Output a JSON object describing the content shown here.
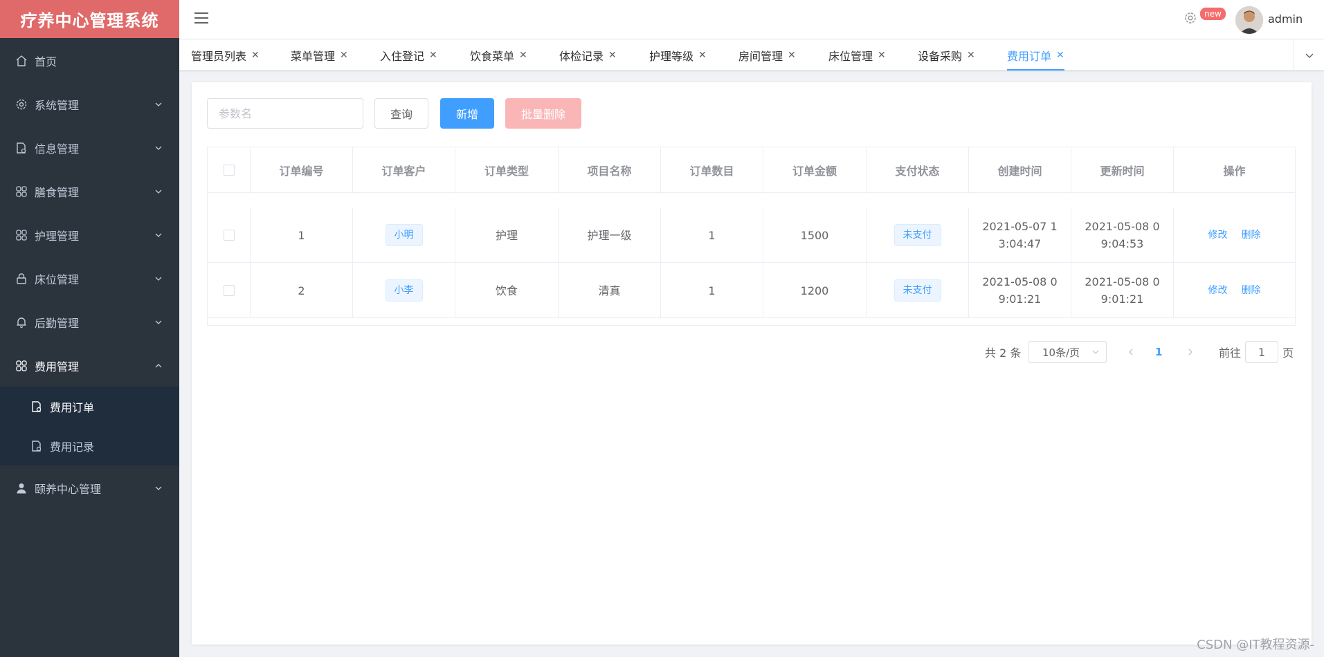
{
  "app": {
    "title": "疗养中心管理系统"
  },
  "sidebar": {
    "items": [
      {
        "label": "首页",
        "icon": "home-icon"
      },
      {
        "label": "系统管理",
        "icon": "gear-icon"
      },
      {
        "label": "信息管理",
        "icon": "document-gear-icon"
      },
      {
        "label": "膳食管理",
        "icon": "grid-icon"
      },
      {
        "label": "护理管理",
        "icon": "grid-icon"
      },
      {
        "label": "床位管理",
        "icon": "lock-icon"
      },
      {
        "label": "后勤管理",
        "icon": "bell-icon"
      },
      {
        "label": "费用管理",
        "icon": "grid-icon"
      },
      {
        "label": "颐养中心管理",
        "icon": "user-icon"
      }
    ],
    "sub_items": [
      {
        "label": "费用订单",
        "icon": "document-gear-icon"
      },
      {
        "label": "费用记录",
        "icon": "document-gear-icon"
      }
    ]
  },
  "header": {
    "badge": "new",
    "username": "admin"
  },
  "tabs": [
    {
      "label": "管理员列表"
    },
    {
      "label": "菜单管理"
    },
    {
      "label": "入住登记"
    },
    {
      "label": "饮食菜单"
    },
    {
      "label": "体检记录"
    },
    {
      "label": "护理等级"
    },
    {
      "label": "房间管理"
    },
    {
      "label": "床位管理"
    },
    {
      "label": "设备采购"
    },
    {
      "label": "费用订单"
    }
  ],
  "toolbar": {
    "search_placeholder": "参数名",
    "query_label": "查询",
    "add_label": "新增",
    "batch_delete_label": "批量删除"
  },
  "table": {
    "columns": [
      "订单编号",
      "订单客户",
      "订单类型",
      "项目名称",
      "订单数目",
      "订单金额",
      "支付状态",
      "创建时间",
      "更新时间",
      "操作"
    ],
    "rows": [
      {
        "id": "1",
        "customer": "小明",
        "type": "护理",
        "project": "护理一级",
        "count": "1",
        "amount": "1500",
        "status": "未支付",
        "created": "2021-05-07 13:04:47",
        "updated": "2021-05-08 09:04:53"
      },
      {
        "id": "2",
        "customer": "小李",
        "type": "饮食",
        "project": "清真",
        "count": "1",
        "amount": "1200",
        "status": "未支付",
        "created": "2021-05-08 09:01:21",
        "updated": "2021-05-08 09:01:21"
      }
    ],
    "edit_label": "修改",
    "delete_label": "删除"
  },
  "pagination": {
    "total": "共 2 条",
    "page_size": "10条/页",
    "current": "1",
    "goto_prefix": "前往",
    "goto_value": "1",
    "goto_suffix": "页"
  },
  "watermark": "CSDN @IT教程资源-",
  "colors": {
    "logo_bg": "#e06a6a",
    "sidebar_bg": "#2b333d",
    "primary": "#409eff",
    "danger_light": "#fab6b6"
  }
}
